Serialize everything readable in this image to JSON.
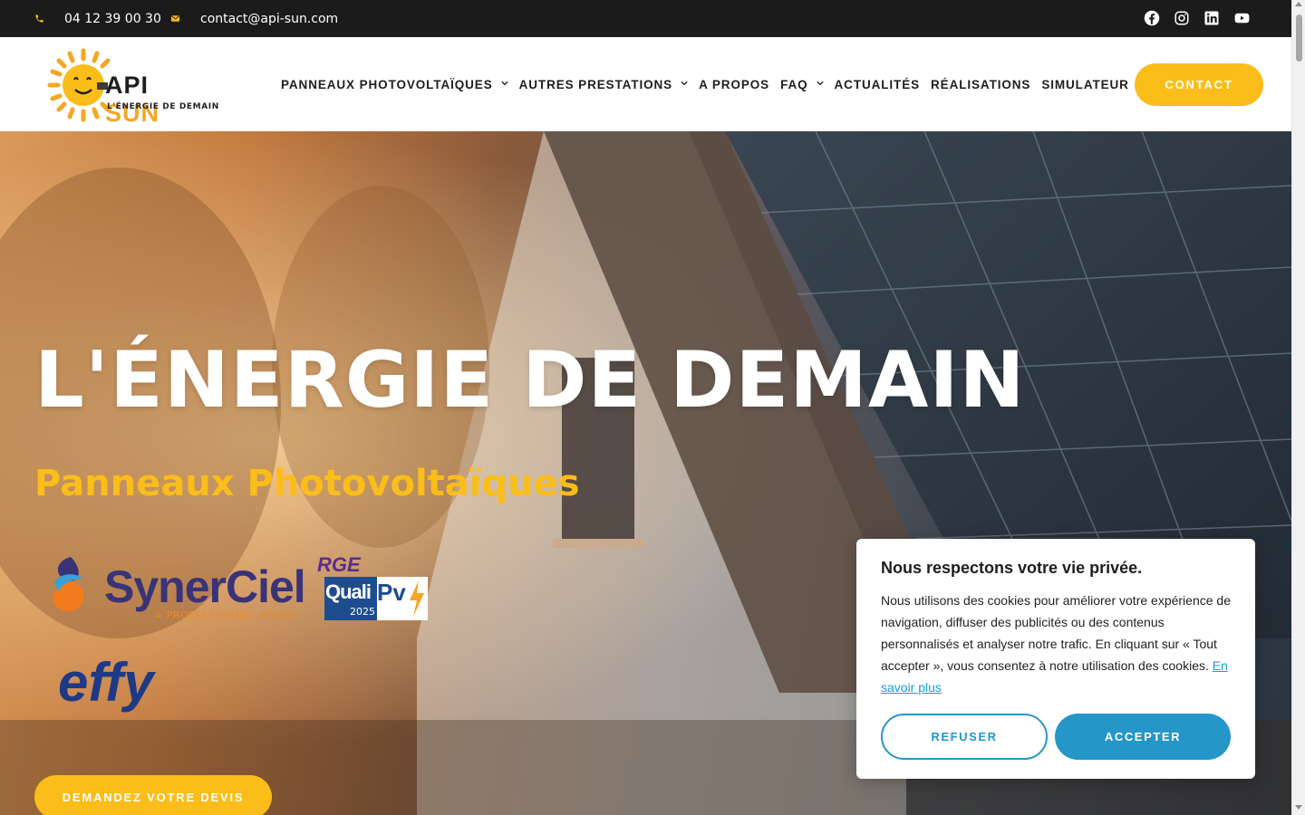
{
  "topbar": {
    "phone": "04 12 39 00 30",
    "email": "contact@api-sun.com",
    "socials": [
      {
        "name": "Facebook",
        "icon": "facebook-icon"
      },
      {
        "name": "Instagram",
        "icon": "instagram-icon"
      },
      {
        "name": "LinkedIn",
        "icon": "linkedin-icon"
      },
      {
        "name": "YouTube",
        "icon": "youtube-icon"
      }
    ]
  },
  "logo": {
    "brand_api": "API",
    "brand_sun": "SUN",
    "tagline": "L'ÉNERGIE DE DEMAIN"
  },
  "nav": {
    "items": [
      {
        "label": "PANNEAUX PHOTOVOLTAÏQUES",
        "dropdown": true
      },
      {
        "label": "AUTRES PRESTATIONS",
        "dropdown": true
      },
      {
        "label": "A PROPOS",
        "dropdown": false
      },
      {
        "label": "FAQ",
        "dropdown": true
      },
      {
        "label": "ACTUALITÉS",
        "dropdown": false
      },
      {
        "label": "RÉALISATIONS",
        "dropdown": false
      },
      {
        "label": "SIMULATEUR",
        "dropdown": false
      }
    ],
    "contact_label": "CONTACT"
  },
  "hero": {
    "title": "L'ÉNERGIE DE DEMAIN",
    "subtitle": "Panneaux Photovoltaïques",
    "badges": {
      "synerciel_name": "SynerCiel",
      "synerciel_sub": "> PROFESSIONNEL AGRÉÉ",
      "rge": "RGE",
      "quali": "Quali",
      "pv": "Pv",
      "year": "2025",
      "effy": "effy"
    },
    "cta_label": "DEMANDEZ VOTRE DEVIS"
  },
  "cookie": {
    "title": "Nous respectons votre vie privée.",
    "text": "Nous utilisons des cookies pour améliorer votre expérience de navigation, diffuser des publicités ou des contenus personnalisés et analyser notre trafic. En cliquant sur « Tout accepter », vous consentez à notre utilisation des cookies.",
    "link": "En savoir plus",
    "refuse_label": "REFUSER",
    "accept_label": "ACCEPTER"
  },
  "colors": {
    "accent": "#fbbd1a",
    "topbar_bg": "#1b1b1b",
    "cookie_blue": "#2596c8"
  }
}
